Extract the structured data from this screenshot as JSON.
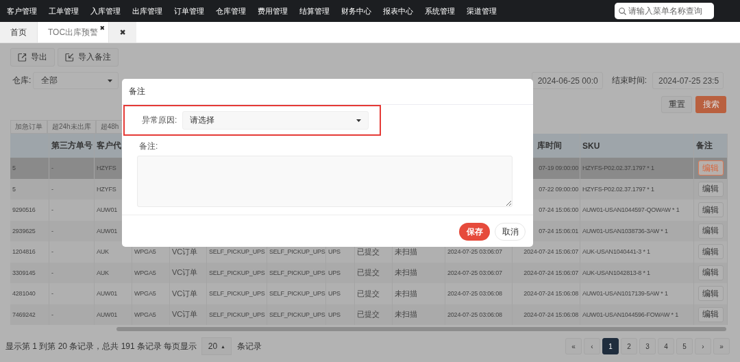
{
  "top_nav": {
    "items": [
      "客户管理",
      "工单管理",
      "入库管理",
      "出库管理",
      "订单管理",
      "仓库管理",
      "费用管理",
      "结算管理",
      "财务中心",
      "报表中心",
      "系统管理",
      "渠道管理"
    ],
    "search": {
      "placeholder": "请输入菜单名称查询"
    }
  },
  "tab_bar": {
    "tabs": [
      {
        "label": "首页",
        "selected": false
      },
      {
        "label": "TOC出库预警",
        "selected": true,
        "close_mark": "✖"
      }
    ],
    "close_all": "✖"
  },
  "toolbar": [
    {
      "kind": "export",
      "label": "导出"
    },
    {
      "kind": "import",
      "label": "导入备注"
    }
  ],
  "filters": {
    "warehouse": {
      "label": "仓库:",
      "value": "全部"
    },
    "start_time": {
      "value": "2024-06-25 00:0"
    },
    "end_time": {
      "label": "结束时间:",
      "value": "2024-07-25 23:5"
    },
    "reset": "重置",
    "search": "搜索"
  },
  "quick_tabs": [
    "加急订单",
    "超24h未出库",
    "超48h"
  ],
  "table": {
    "columns": [
      null,
      "第三方单号",
      "客户代",
      null,
      null,
      null,
      null,
      null,
      null,
      null,
      null,
      "库时间",
      "SKU",
      "备注"
    ],
    "rows": [
      {
        "selected": true,
        "cells": [
          "5",
          "-",
          "HZYFS",
          null,
          null,
          null,
          null,
          null,
          null,
          null,
          null,
          "07-19 09:00:00",
          "HZYFS-P02.02.37.1797 * 1"
        ],
        "action": "编辑"
      },
      {
        "selected": false,
        "cells": [
          "5",
          "-",
          "HZYFS",
          null,
          null,
          null,
          null,
          null,
          null,
          null,
          null,
          "07-22 09:00:00",
          "HZYFS-P02.02.37.1797 * 1"
        ],
        "action": "编辑"
      },
      {
        "selected": false,
        "cells": [
          "9290516",
          "-",
          "AUW01",
          null,
          null,
          null,
          null,
          null,
          null,
          null,
          null,
          "07-24 15:06:00",
          "AUW01-USAN1044597-QOWAW * 1"
        ],
        "action": "编辑"
      },
      {
        "selected": false,
        "cells": [
          "2939625",
          "-",
          "AUW01",
          null,
          null,
          null,
          null,
          null,
          null,
          null,
          null,
          "07-24 15:06:01",
          "AUW01-USAN1038736-3AW * 1"
        ],
        "action": "编辑"
      },
      {
        "selected": false,
        "cells": [
          "1204816",
          "-",
          "AUK",
          "WPGA5",
          "VC订单",
          "SELF_PICKUP_UPS",
          "SELF_PICKUP_UPS",
          "UPS",
          "已提交",
          "未扫描",
          "2024-07-25 03:06:07",
          "2024-07-24 15:06:07",
          "AUK-USAN1040441-3 * 1"
        ],
        "action": "编辑"
      },
      {
        "selected": false,
        "cells": [
          "3309145",
          "-",
          "AUK",
          "WPGA5",
          "VC订单",
          "SELF_PICKUP_UPS",
          "SELF_PICKUP_UPS",
          "UPS",
          "已提交",
          "未扫描",
          "2024-07-25 03:06:07",
          "2024-07-24 15:06:07",
          "AUK-USAN1042813-8 * 1"
        ],
        "action": "编辑"
      },
      {
        "selected": false,
        "cells": [
          "4281040",
          "-",
          "AUW01",
          "WPGA5",
          "VC订单",
          "SELF_PICKUP_UPS",
          "SELF_PICKUP_UPS",
          "UPS",
          "已提交",
          "未扫描",
          "2024-07-25 03:06:08",
          "2024-07-24 15:06:08",
          "AUW01-USAN1017139-5AW * 1"
        ],
        "action": "编辑"
      },
      {
        "selected": false,
        "cells": [
          "7469242",
          "-",
          "AUW01",
          "WPGA5",
          "VC订单",
          "SELF_PICKUP_UPS",
          "SELF_PICKUP_UPS",
          "UPS",
          "已提交",
          "未扫描",
          "2024-07-25 03:06:08",
          "2024-07-24 15:06:08",
          "AUW01-USAN1044596-FOWAW * 1"
        ],
        "action": "编辑"
      }
    ]
  },
  "footer": {
    "summary": "显示第 1 到第 20 条记录，总共 191 条记录 每页显示",
    "page_size": "20",
    "page_size_caret": "▲",
    "suffix": "条记录"
  },
  "pagination": [
    {
      "label": "«",
      "selected": false
    },
    {
      "label": "‹",
      "selected": false
    },
    {
      "label": "1",
      "selected": true
    },
    {
      "label": "2",
      "selected": false
    },
    {
      "label": "3",
      "selected": false
    },
    {
      "label": "4",
      "selected": false
    },
    {
      "label": "5",
      "selected": false
    },
    {
      "label": "›",
      "selected": false
    },
    {
      "label": "»",
      "selected": false
    }
  ],
  "dialog": {
    "title": "备注",
    "reason": {
      "label": "异常原因:",
      "placeholder": "请选择",
      "highlighted": true
    },
    "note": {
      "label": "备注:"
    },
    "buttons": [
      {
        "kind": "primary",
        "label": "保存"
      },
      {
        "kind": "default",
        "label": "取消"
      }
    ]
  }
}
